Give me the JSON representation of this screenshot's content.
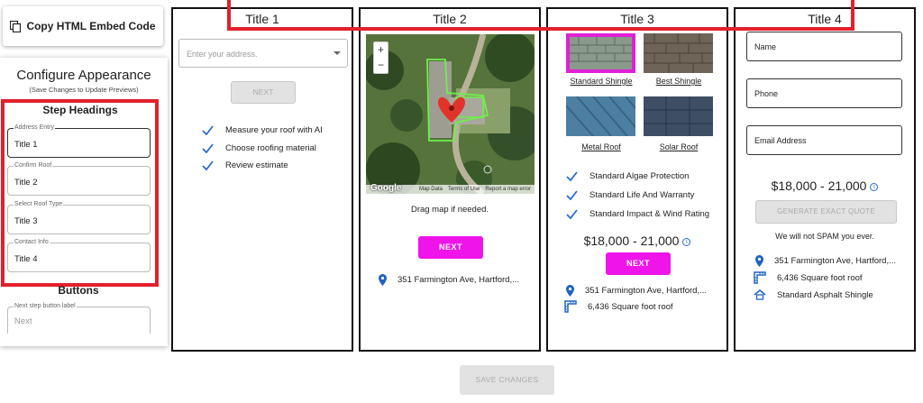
{
  "copy_button": {
    "label": "Copy HTML Embed Code"
  },
  "config": {
    "title": "Configure Appearance",
    "subtitle": "(Save Changes to Update Previews)",
    "step_headings_title": "Step Headings",
    "fields": [
      {
        "label": "Address Entry",
        "value": "Title 1"
      },
      {
        "label": "Confirm Roof",
        "value": "Title 2"
      },
      {
        "label": "Select Roof Type",
        "value": "Title 3"
      },
      {
        "label": "Contact Info",
        "value": "Title 4"
      }
    ],
    "buttons_title": "Buttons",
    "next_button_field": {
      "label": "Next step button label",
      "placeholder": "Next"
    }
  },
  "step1": {
    "title": "Title 1",
    "address_placeholder": "Enter your address.",
    "next_label": "NEXT",
    "features": [
      "Measure your roof with AI",
      "Choose roofing material",
      "Review estimate"
    ]
  },
  "step2": {
    "title": "Title 2",
    "map": {
      "zoom_in": "+",
      "zoom_out": "−",
      "google": "Google",
      "map_data": "Map Data",
      "terms": "Terms of Use",
      "report": "Report a map error"
    },
    "drag_text": "Drag map if needed.",
    "next_label": "NEXT",
    "address": "351 Farmington Ave, Hartford,..."
  },
  "step3": {
    "title": "Title 3",
    "roof_types": [
      "Standard Shingle",
      "Best Shingle",
      "Metal Roof",
      "Solar Roof"
    ],
    "selected_roof": "Standard Shingle",
    "features": [
      "Standard Algae Protection",
      "Standard Life And Warranty",
      "Standard Impact & Wind Rating"
    ],
    "price": "$18,000 - 21,000",
    "next_label": "NEXT",
    "address": "351 Farmington Ave, Hartford,...",
    "area": "6,436 Square foot roof"
  },
  "step4": {
    "title": "Title 4",
    "fields": [
      "Name",
      "Phone",
      "Email Address"
    ],
    "price": "$18,000 - 21,000",
    "generate_label": "GENERATE EXACT QUOTE",
    "spam_text": "We will not SPAM you ever.",
    "address": "351 Farmington Ave, Hartford,...",
    "area": "6,436 Square foot roof",
    "shingle": "Standard Asphalt Shingle"
  },
  "save_button": {
    "label": "SAVE CHANGES"
  },
  "colors": {
    "accent_magenta": "#ee14ea",
    "highlight_red": "#e3202b",
    "check_blue": "#2a6ccf",
    "selected_border": "#e020d8"
  }
}
